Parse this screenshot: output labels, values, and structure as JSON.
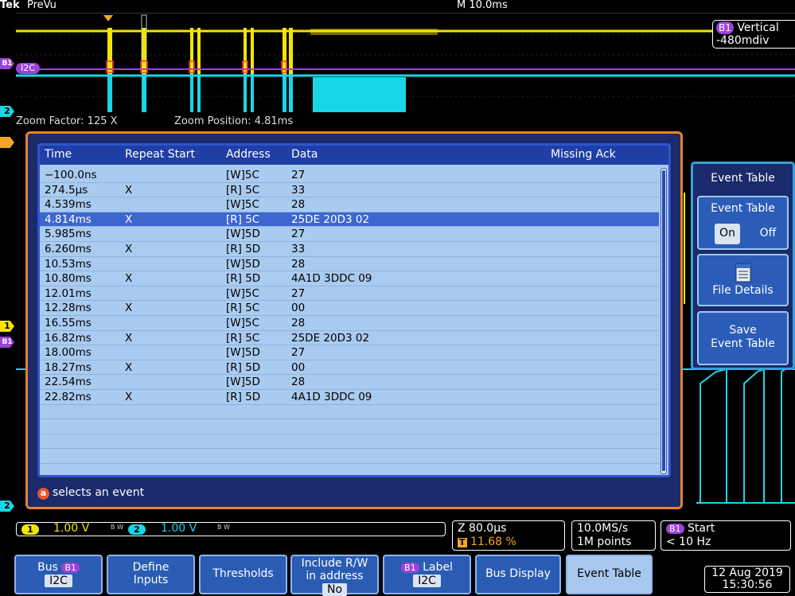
{
  "topbar": {
    "brand": "Tek",
    "mode": "PreVu",
    "timebase": "M 10.0ms"
  },
  "overview": {
    "vertical_badge": {
      "bus": "B1",
      "label": "Vertical",
      "value": "-480mdiv"
    },
    "bus_label": "I2C"
  },
  "zoom_info": {
    "factor": "Zoom Factor: 125 X",
    "position": "Zoom Position: 4.81ms"
  },
  "markers": {
    "trigger": "T",
    "ch1": "1",
    "ch2": "2",
    "bus": "B1"
  },
  "event_table": {
    "columns": {
      "time": "Time",
      "repeat_start": "Repeat Start",
      "address": "Address",
      "data": "Data",
      "missing_ack": "Missing Ack"
    },
    "rows": [
      {
        "time": "−100.0ns",
        "repeat": "",
        "address": "[W]5C",
        "data": "27"
      },
      {
        "time": "274.5µs",
        "repeat": "X",
        "address": "[R] 5C",
        "data": "33"
      },
      {
        "time": "4.539ms",
        "repeat": "",
        "address": "[W]5C",
        "data": "28"
      },
      {
        "time": "4.814ms",
        "repeat": "X",
        "address": "[R] 5C",
        "data": "25DE 20D3 02",
        "selected": true
      },
      {
        "time": "5.985ms",
        "repeat": "",
        "address": "[W]5D",
        "data": "27"
      },
      {
        "time": "6.260ms",
        "repeat": "X",
        "address": "[R] 5D",
        "data": "33"
      },
      {
        "time": "10.53ms",
        "repeat": "",
        "address": "[W]5D",
        "data": "28"
      },
      {
        "time": "10.80ms",
        "repeat": "X",
        "address": "[R] 5D",
        "data": "4A1D 3DDC 09"
      },
      {
        "time": "12.01ms",
        "repeat": "",
        "address": "[W]5C",
        "data": "27"
      },
      {
        "time": "12.28ms",
        "repeat": "X",
        "address": "[R] 5C",
        "data": "00"
      },
      {
        "time": "16.55ms",
        "repeat": "",
        "address": "[W]5C",
        "data": "28"
      },
      {
        "time": "16.82ms",
        "repeat": "X",
        "address": "[R] 5C",
        "data": "25DE 20D3 02"
      },
      {
        "time": "18.00ms",
        "repeat": "",
        "address": "[W]5D",
        "data": "27"
      },
      {
        "time": "18.27ms",
        "repeat": "X",
        "address": "[R] 5D",
        "data": "00"
      },
      {
        "time": "22.54ms",
        "repeat": "",
        "address": "[W]5D",
        "data": "28"
      },
      {
        "time": "22.82ms",
        "repeat": "X",
        "address": "[R] 5D",
        "data": "4A1D 3DDC 09"
      },
      {
        "time": "",
        "repeat": "",
        "address": "",
        "data": ""
      },
      {
        "time": "",
        "repeat": "",
        "address": "",
        "data": ""
      },
      {
        "time": "",
        "repeat": "",
        "address": "",
        "data": ""
      },
      {
        "time": "",
        "repeat": "",
        "address": "",
        "data": ""
      },
      {
        "time": "",
        "repeat": "",
        "address": "",
        "data": ""
      }
    ],
    "hint_knob": "a",
    "hint": "selects an event"
  },
  "side_menu": {
    "title": "Event Table",
    "toggle_label": "Event Table",
    "on": "On",
    "off": "Off",
    "file_details": "File Details",
    "save_line1": "Save",
    "save_line2": "Event Table"
  },
  "status": {
    "ch1_badge": "1",
    "ch1_value": "1.00 V",
    "ch2_badge": "2",
    "ch2_value": "1.00 V",
    "bw": "B W",
    "zoom_scale": "Z 80.0µs",
    "trigger_badge": "T",
    "trigger_pos": "11.68 %",
    "sample_rate": "10.0MS/s",
    "record_length": "1M points",
    "trigger_bus": "B1",
    "trigger_type": "Start",
    "trigger_freq": "< 10 Hz"
  },
  "bottom_menu": {
    "bus_label": "Bus",
    "bus_badge": "B1",
    "bus_value": "I2C",
    "define_line1": "Define",
    "define_line2": "Inputs",
    "thresholds": "Thresholds",
    "include_line1": "Include R/W",
    "include_line2": "in address",
    "include_value": "No",
    "label_badge": "B1",
    "label_label": "Label",
    "label_value": "I2C",
    "bus_display": "Bus Display",
    "event_table": "Event Table"
  },
  "datetime": {
    "date": "12 Aug 2019",
    "time": "15:30:56"
  },
  "colors": {
    "ch1": "#f2e600",
    "ch2": "#19d6e6",
    "bus": "#9b43d8",
    "trigger": "#f3a624",
    "dialog_border": "#e8822c"
  },
  "icons": [
    "file-details-icon",
    "trigger-marker-icon",
    "knob-a-icon"
  ]
}
